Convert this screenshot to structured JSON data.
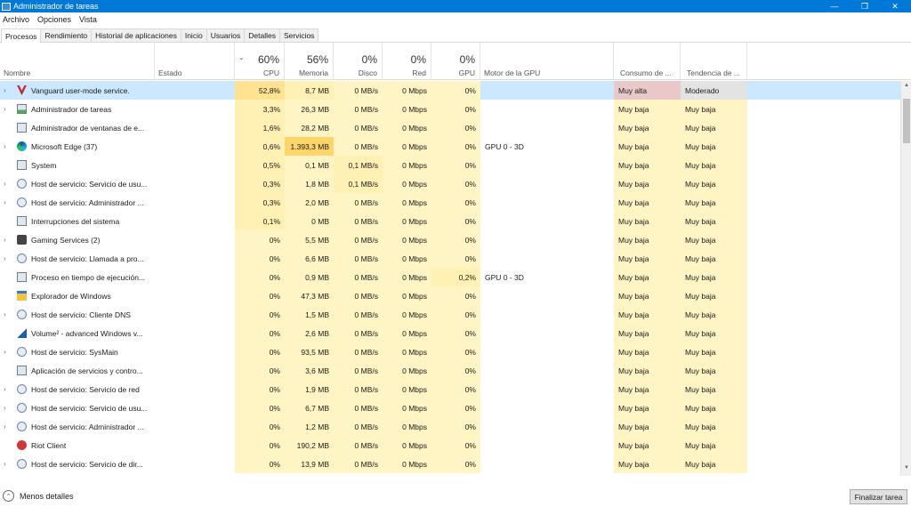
{
  "window": {
    "title": "Administrador de tareas",
    "minimize_glyph": "—",
    "restore_glyph": "❐",
    "close_glyph": "✕"
  },
  "menu": [
    "Archivo",
    "Opciones",
    "Vista"
  ],
  "tabs": [
    "Procesos",
    "Rendimiento",
    "Historial de aplicaciones",
    "Inicio",
    "Usuarios",
    "Detalles",
    "Servicios"
  ],
  "columns": {
    "name": "Nombre",
    "status": "Estado",
    "cpu": {
      "pct": "60%",
      "label": "CPU"
    },
    "memory": {
      "pct": "56%",
      "label": "Memoria"
    },
    "disk": {
      "pct": "0%",
      "label": "Disco"
    },
    "network": {
      "pct": "0%",
      "label": "Red"
    },
    "gpu": {
      "pct": "0%",
      "label": "GPU"
    },
    "gpu_engine": "Motor de la GPU",
    "power": "Consumo de ...",
    "trend": "Tendencia de ..."
  },
  "processes": [
    {
      "name": "Vanguard user-mode service.",
      "cpu": "52,8%",
      "mem": "8,7 MB",
      "disk": "0 MB/s",
      "net": "0 Mbps",
      "gpu": "0%",
      "engine": "",
      "power": "Muy alta",
      "trend": "Moderado",
      "icon": "vanguard-icon",
      "expand": true
    },
    {
      "name": "Administrador de tareas",
      "cpu": "3,3%",
      "mem": "26,3 MB",
      "disk": "0 MB/s",
      "net": "0 Mbps",
      "gpu": "0%",
      "engine": "",
      "power": "Muy baja",
      "trend": "Muy baja",
      "icon": "task-manager-icon",
      "expand": true
    },
    {
      "name": "Administrador de ventanas de e...",
      "cpu": "1,6%",
      "mem": "28,2 MB",
      "disk": "0 MB/s",
      "net": "0 Mbps",
      "gpu": "0%",
      "engine": "",
      "power": "Muy baja",
      "trend": "Muy baja",
      "icon": "window-icon",
      "expand": false
    },
    {
      "name": "Microsoft Edge (37)",
      "cpu": "0,6%",
      "mem": "1.393,3 MB",
      "disk": "0 MB/s",
      "net": "0 Mbps",
      "gpu": "0%",
      "engine": "GPU 0 - 3D",
      "power": "Muy baja",
      "trend": "Muy baja",
      "icon": "edge-icon",
      "expand": true
    },
    {
      "name": "System",
      "cpu": "0,5%",
      "mem": "0,1 MB",
      "disk": "0,1 MB/s",
      "net": "0 Mbps",
      "gpu": "0%",
      "engine": "",
      "power": "Muy baja",
      "trend": "Muy baja",
      "icon": "window-icon",
      "expand": false
    },
    {
      "name": "Host de servicio: Servicio de usu...",
      "cpu": "0,3%",
      "mem": "1,8 MB",
      "disk": "0,1 MB/s",
      "net": "0 Mbps",
      "gpu": "0%",
      "engine": "",
      "power": "Muy baja",
      "trend": "Muy baja",
      "icon": "gear-icon",
      "expand": true
    },
    {
      "name": "Host de servicio: Administrador ...",
      "cpu": "0,3%",
      "mem": "2,0 MB",
      "disk": "0 MB/s",
      "net": "0 Mbps",
      "gpu": "0%",
      "engine": "",
      "power": "Muy baja",
      "trend": "Muy baja",
      "icon": "gear-icon",
      "expand": true
    },
    {
      "name": "Interrupciones del sistema",
      "cpu": "0,1%",
      "mem": "0 MB",
      "disk": "0 MB/s",
      "net": "0 Mbps",
      "gpu": "0%",
      "engine": "",
      "power": "Muy baja",
      "trend": "Muy baja",
      "icon": "window-icon",
      "expand": false
    },
    {
      "name": "Gaming Services (2)",
      "cpu": "0%",
      "mem": "5,5 MB",
      "disk": "0 MB/s",
      "net": "0 Mbps",
      "gpu": "0%",
      "engine": "",
      "power": "Muy baja",
      "trend": "Muy baja",
      "icon": "xbox-icon",
      "expand": true
    },
    {
      "name": "Host de servicio: Llamada a pro...",
      "cpu": "0%",
      "mem": "6,6 MB",
      "disk": "0 MB/s",
      "net": "0 Mbps",
      "gpu": "0%",
      "engine": "",
      "power": "Muy baja",
      "trend": "Muy baja",
      "icon": "gear-icon",
      "expand": true
    },
    {
      "name": "Proceso en tiempo de ejecución...",
      "cpu": "0%",
      "mem": "0,9 MB",
      "disk": "0 MB/s",
      "net": "0 Mbps",
      "gpu": "0,2%",
      "engine": "GPU 0 - 3D",
      "power": "Muy baja",
      "trend": "Muy baja",
      "icon": "window-icon",
      "expand": false
    },
    {
      "name": "Explorador de Windows",
      "cpu": "0%",
      "mem": "47,3 MB",
      "disk": "0 MB/s",
      "net": "0 Mbps",
      "gpu": "0%",
      "engine": "",
      "power": "Muy baja",
      "trend": "Muy baja",
      "icon": "folder-icon",
      "expand": false
    },
    {
      "name": "Host de servicio: Cliente DNS",
      "cpu": "0%",
      "mem": "1,5 MB",
      "disk": "0 MB/s",
      "net": "0 Mbps",
      "gpu": "0%",
      "engine": "",
      "power": "Muy baja",
      "trend": "Muy baja",
      "icon": "gear-icon",
      "expand": true
    },
    {
      "name": "Volume² - advanced Windows v...",
      "cpu": "0%",
      "mem": "2,6 MB",
      "disk": "0 MB/s",
      "net": "0 Mbps",
      "gpu": "0%",
      "engine": "",
      "power": "Muy baja",
      "trend": "Muy baja",
      "icon": "volume-icon",
      "expand": false
    },
    {
      "name": "Host de servicio: SysMain",
      "cpu": "0%",
      "mem": "93,5 MB",
      "disk": "0 MB/s",
      "net": "0 Mbps",
      "gpu": "0%",
      "engine": "",
      "power": "Muy baja",
      "trend": "Muy baja",
      "icon": "gear-icon",
      "expand": true
    },
    {
      "name": "Aplicación de servicios y contro...",
      "cpu": "0%",
      "mem": "3,6 MB",
      "disk": "0 MB/s",
      "net": "0 Mbps",
      "gpu": "0%",
      "engine": "",
      "power": "Muy baja",
      "trend": "Muy baja",
      "icon": "window-icon",
      "expand": false
    },
    {
      "name": "Host de servicio: Servicio de red",
      "cpu": "0%",
      "mem": "1,9 MB",
      "disk": "0 MB/s",
      "net": "0 Mbps",
      "gpu": "0%",
      "engine": "",
      "power": "Muy baja",
      "trend": "Muy baja",
      "icon": "gear-icon",
      "expand": true
    },
    {
      "name": "Host de servicio: Servicio de usu...",
      "cpu": "0%",
      "mem": "6,7 MB",
      "disk": "0 MB/s",
      "net": "0 Mbps",
      "gpu": "0%",
      "engine": "",
      "power": "Muy baja",
      "trend": "Muy baja",
      "icon": "gear-icon",
      "expand": true
    },
    {
      "name": "Host de servicio: Administrador ...",
      "cpu": "0%",
      "mem": "1,2 MB",
      "disk": "0 MB/s",
      "net": "0 Mbps",
      "gpu": "0%",
      "engine": "",
      "power": "Muy baja",
      "trend": "Muy baja",
      "icon": "gear-icon",
      "expand": true
    },
    {
      "name": "Riot Client",
      "cpu": "0%",
      "mem": "190,2 MB",
      "disk": "0 MB/s",
      "net": "0 Mbps",
      "gpu": "0%",
      "engine": "",
      "power": "Muy baja",
      "trend": "Muy baja",
      "icon": "riot-icon",
      "expand": false
    },
    {
      "name": "Host de servicio: Servicio de dir...",
      "cpu": "0%",
      "mem": "13,9 MB",
      "disk": "0 MB/s",
      "net": "0 Mbps",
      "gpu": "0%",
      "engine": "",
      "power": "Muy baja",
      "trend": "Muy baja",
      "icon": "gear-icon",
      "expand": true
    }
  ],
  "footer": {
    "less_details": "Menos detalles",
    "end_task": "Finalizar tarea"
  },
  "colors": {
    "titlebar": "#0078d7",
    "selected_row": "#cce8ff",
    "heat_low": "#fff4c4",
    "heat_mid": "#ffe390",
    "heat_high": "#ffd56a",
    "power_high": "#e8c8c8"
  }
}
